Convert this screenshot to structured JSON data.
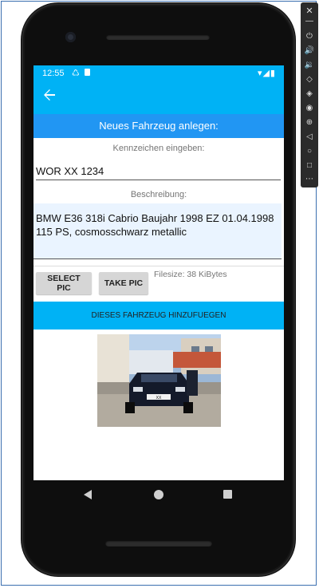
{
  "status": {
    "time": "12:55",
    "icon_left": "notification-icons",
    "icon_right": "wifi-signal-battery-icons"
  },
  "appbar": {
    "back_icon": "arrow-back-icon"
  },
  "form": {
    "section_title": "Neues Fahrzeug anlegen:",
    "plate_label": "Kennzeichen eingeben:",
    "plate_value": "WOR XX 1234",
    "desc_label": "Beschreibung:",
    "desc_value": "BMW E36 318i Cabrio Baujahr 1998 EZ 01.04.1998 115 PS, cosmosschwarz metallic",
    "select_pic_label": "SELECT PIC",
    "take_pic_label": "TAKE PIC",
    "filesize_text": "Filesize: 38 KiBytes",
    "add_button_label": "DIESES FAHRZEUG HINZUFUEGEN"
  },
  "photo": {
    "plate_text": "XX"
  },
  "colors": {
    "accent": "#00b2f5",
    "section_header": "#2196f3",
    "input_bg": "#eaf4ff"
  },
  "side_toolbar_icons": [
    "close-icon",
    "minimize-icon",
    "power-icon",
    "volume-up-icon",
    "volume-down-icon",
    "rotate-left-icon",
    "rotate-right-icon",
    "camera-icon",
    "zoom-icon",
    "back-icon",
    "home-icon",
    "overview-icon",
    "more-icon"
  ]
}
